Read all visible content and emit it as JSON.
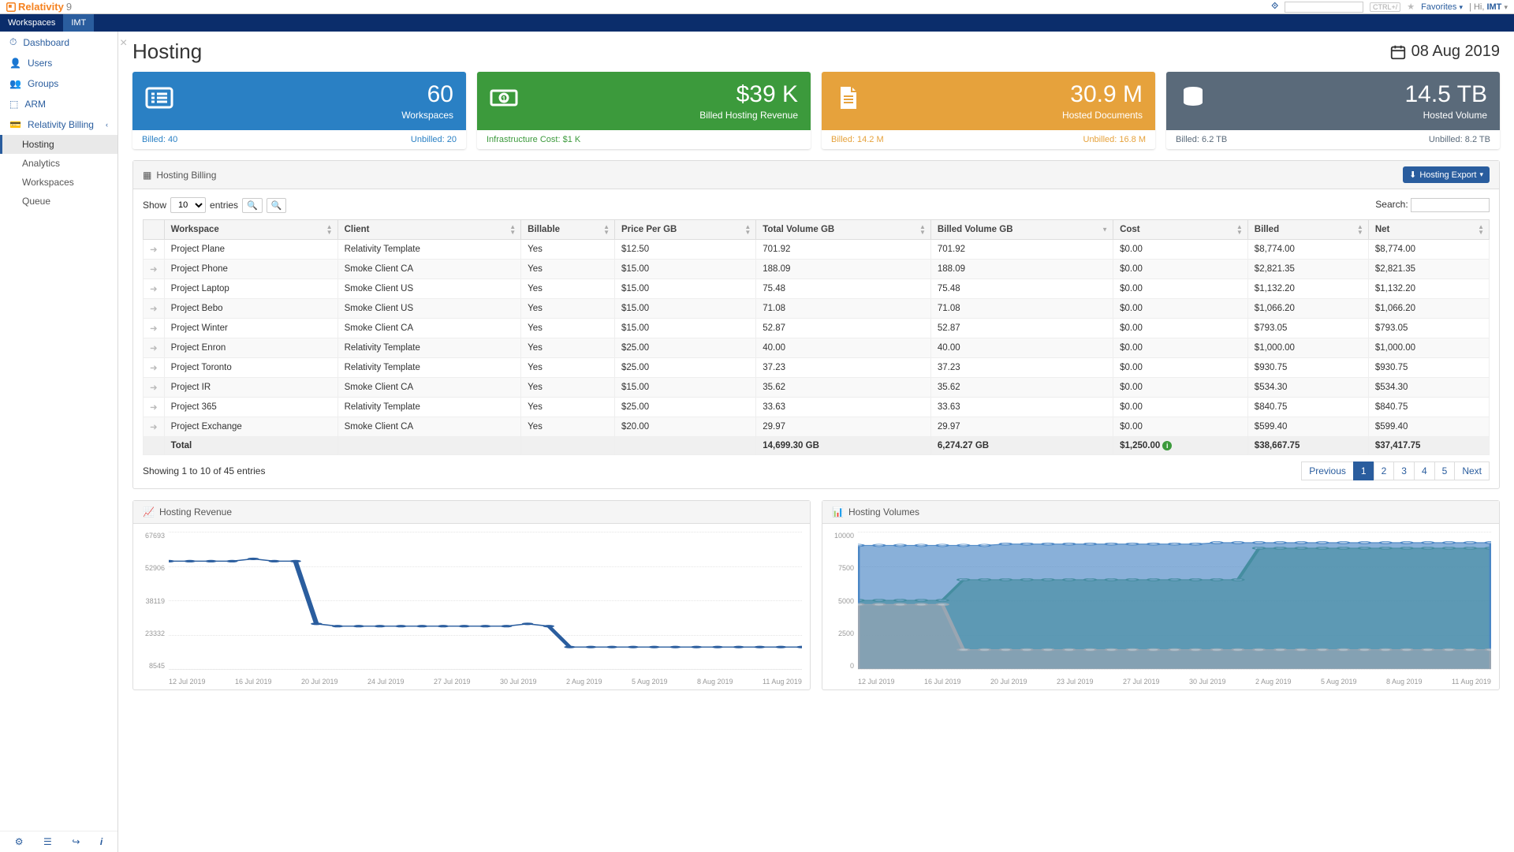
{
  "brand": {
    "name": "Relativity",
    "version": "9"
  },
  "topbar": {
    "search_placeholder": "",
    "shortcut": "CTRL+/",
    "favorites": "Favorites",
    "greeting": "Hi,",
    "user": "IMT"
  },
  "bluebar": {
    "tabs": [
      "Workspaces",
      "IMT"
    ],
    "active": 1
  },
  "sidebar": {
    "items": [
      {
        "icon": "dashboard",
        "label": "Dashboard"
      },
      {
        "icon": "user",
        "label": "Users"
      },
      {
        "icon": "group",
        "label": "Groups"
      },
      {
        "icon": "cube",
        "label": "ARM"
      },
      {
        "icon": "card",
        "label": "Relativity Billing",
        "expandable": true
      }
    ],
    "sub": [
      "Hosting",
      "Analytics",
      "Workspaces",
      "Queue"
    ],
    "active_sub": 0
  },
  "page": {
    "title": "Hosting",
    "date": "08 Aug 2019"
  },
  "cards": [
    {
      "cls": "c-blue",
      "icon": "list",
      "value": "60",
      "label": "Workspaces",
      "foot_l": "Billed: 40",
      "foot_r": "Unbilled: 20"
    },
    {
      "cls": "c-green",
      "icon": "money",
      "value": "$39 K",
      "label": "Billed Hosting Revenue",
      "foot_l": "Infrastructure Cost: $1 K",
      "foot_r": ""
    },
    {
      "cls": "c-orange",
      "icon": "doc",
      "value": "30.9 M",
      "label": "Hosted Documents",
      "foot_l": "Billed: 14.2 M",
      "foot_r": "Unbilled: 16.8 M"
    },
    {
      "cls": "c-slate",
      "icon": "db",
      "value": "14.5 TB",
      "label": "Hosted Volume",
      "foot_l": "Billed: 6.2 TB",
      "foot_r": "Unbilled: 8.2 TB"
    }
  ],
  "billing": {
    "panel_title": "Hosting Billing",
    "export_label": "Hosting Export",
    "show_label": "Show",
    "entries_label": "entries",
    "page_size": "10",
    "search_label": "Search:",
    "columns": [
      "",
      "Workspace",
      "Client",
      "Billable",
      "Price Per GB",
      "Total Volume GB",
      "Billed Volume GB",
      "Cost",
      "Billed",
      "Net"
    ],
    "rows": [
      {
        "workspace": "Project Plane",
        "client": "Relativity Template",
        "billable": "Yes",
        "price": "$12.50",
        "total": "701.92",
        "billedv": "701.92",
        "cost": "$0.00",
        "billed": "$8,774.00",
        "net": "$8,774.00"
      },
      {
        "workspace": "Project Phone",
        "client": "Smoke Client CA",
        "billable": "Yes",
        "price": "$15.00",
        "total": "188.09",
        "billedv": "188.09",
        "cost": "$0.00",
        "billed": "$2,821.35",
        "net": "$2,821.35"
      },
      {
        "workspace": "Project Laptop",
        "client": "Smoke Client US",
        "billable": "Yes",
        "price": "$15.00",
        "total": "75.48",
        "billedv": "75.48",
        "cost": "$0.00",
        "billed": "$1,132.20",
        "net": "$1,132.20"
      },
      {
        "workspace": "Project Bebo",
        "client": "Smoke Client US",
        "billable": "Yes",
        "price": "$15.00",
        "total": "71.08",
        "billedv": "71.08",
        "cost": "$0.00",
        "billed": "$1,066.20",
        "net": "$1,066.20"
      },
      {
        "workspace": "Project Winter",
        "client": "Smoke Client CA",
        "billable": "Yes",
        "price": "$15.00",
        "total": "52.87",
        "billedv": "52.87",
        "cost": "$0.00",
        "billed": "$793.05",
        "net": "$793.05"
      },
      {
        "workspace": "Project Enron",
        "client": "Relativity Template",
        "billable": "Yes",
        "price": "$25.00",
        "total": "40.00",
        "billedv": "40.00",
        "cost": "$0.00",
        "billed": "$1,000.00",
        "net": "$1,000.00"
      },
      {
        "workspace": "Project Toronto",
        "client": "Relativity Template",
        "billable": "Yes",
        "price": "$25.00",
        "total": "37.23",
        "billedv": "37.23",
        "cost": "$0.00",
        "billed": "$930.75",
        "net": "$930.75"
      },
      {
        "workspace": "Project IR",
        "client": "Smoke Client CA",
        "billable": "Yes",
        "price": "$15.00",
        "total": "35.62",
        "billedv": "35.62",
        "cost": "$0.00",
        "billed": "$534.30",
        "net": "$534.30"
      },
      {
        "workspace": "Project 365",
        "client": "Relativity Template",
        "billable": "Yes",
        "price": "$25.00",
        "total": "33.63",
        "billedv": "33.63",
        "cost": "$0.00",
        "billed": "$840.75",
        "net": "$840.75"
      },
      {
        "workspace": "Project Exchange",
        "client": "Smoke Client CA",
        "billable": "Yes",
        "price": "$20.00",
        "total": "29.97",
        "billedv": "29.97",
        "cost": "$0.00",
        "billed": "$599.40",
        "net": "$599.40"
      }
    ],
    "totals": {
      "label": "Total",
      "total": "14,699.30 GB",
      "billedv": "6,274.27 GB",
      "cost": "$1,250.00",
      "billed": "$38,667.75",
      "net": "$37,417.75"
    },
    "info_text": "Showing 1 to 10 of 45 entries",
    "pagination": {
      "prev": "Previous",
      "pages": [
        "1",
        "2",
        "3",
        "4",
        "5"
      ],
      "next": "Next",
      "active": 0
    }
  },
  "chart_revenue": {
    "title": "Hosting Revenue"
  },
  "chart_volumes": {
    "title": "Hosting Volumes"
  },
  "chart_data": [
    {
      "type": "line",
      "title": "Hosting Revenue",
      "xlabel": "",
      "ylabel": "",
      "ylim": [
        8545,
        67693
      ],
      "y_ticks": [
        "67693",
        "52906",
        "38119",
        "23332",
        "8545"
      ],
      "x_ticks": [
        "12 Jul 2019",
        "16 Jul 2019",
        "20 Jul 2019",
        "24 Jul 2019",
        "27 Jul 2019",
        "30 Jul 2019",
        "2 Aug 2019",
        "5 Aug 2019",
        "8 Aug 2019",
        "11 Aug 2019"
      ],
      "series": [
        {
          "name": "revenue",
          "color": "#2a5d9e",
          "values": [
            55000,
            55000,
            55000,
            55000,
            56000,
            55000,
            55000,
            28000,
            27000,
            27000,
            27000,
            27000,
            27000,
            27000,
            27000,
            27000,
            27000,
            28000,
            27000,
            18000,
            18000,
            18000,
            18000,
            18000,
            18000,
            18000,
            18000,
            18000,
            18000,
            18000,
            18000
          ]
        }
      ]
    },
    {
      "type": "area",
      "title": "Hosting Volumes",
      "xlabel": "",
      "ylabel": "",
      "ylim": [
        0,
        10000
      ],
      "y_ticks": [
        "10000",
        "7500",
        "5000",
        "2500",
        "0"
      ],
      "x_ticks": [
        "12 Jul 2019",
        "16 Jul 2019",
        "20 Jul 2019",
        "23 Jul 2019",
        "27 Jul 2019",
        "30 Jul 2019",
        "2 Aug 2019",
        "5 Aug 2019",
        "8 Aug 2019",
        "11 Aug 2019"
      ],
      "series": [
        {
          "name": "series-a",
          "color": "#3c9a5c",
          "values": [
            5000,
            5000,
            5000,
            5000,
            5000,
            6500,
            6500,
            6500,
            6500,
            6500,
            6500,
            6500,
            6500,
            6500,
            6500,
            6500,
            6500,
            6500,
            6500,
            8800,
            8800,
            8800,
            8800,
            8800,
            8800,
            8800,
            8800,
            8800,
            8800,
            8800,
            8800
          ]
        },
        {
          "name": "series-b",
          "color": "#4a86c5",
          "values": [
            9000,
            9000,
            9000,
            9000,
            9000,
            9000,
            9000,
            9100,
            9100,
            9100,
            9100,
            9100,
            9100,
            9100,
            9100,
            9100,
            9100,
            9200,
            9200,
            9200,
            9200,
            9200,
            9200,
            9200,
            9200,
            9200,
            9200,
            9200,
            9200,
            9200,
            9200
          ]
        },
        {
          "name": "series-c",
          "color": "#9aa6b2",
          "values": [
            4700,
            4700,
            4700,
            4700,
            4700,
            1400,
            1400,
            1400,
            1400,
            1400,
            1400,
            1400,
            1400,
            1400,
            1400,
            1400,
            1400,
            1400,
            1400,
            1400,
            1400,
            1400,
            1400,
            1400,
            1400,
            1400,
            1400,
            1400,
            1400,
            1400,
            1400
          ]
        }
      ]
    }
  ]
}
